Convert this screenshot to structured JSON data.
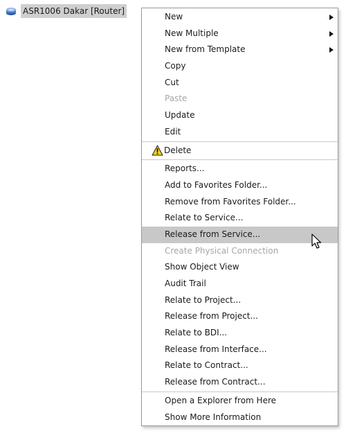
{
  "tree": {
    "node_label": "ASR1006 Dakar [Router]",
    "node_icon": "router-icon"
  },
  "menu": {
    "groups": [
      [
        {
          "label": "New",
          "submenu": true
        },
        {
          "label": "New Multiple",
          "submenu": true
        },
        {
          "label": "New from Template",
          "submenu": true
        },
        {
          "label": "Copy"
        },
        {
          "label": "Cut"
        },
        {
          "label": "Paste",
          "disabled": true
        },
        {
          "label": "Update"
        },
        {
          "label": "Edit"
        }
      ],
      [
        {
          "label": "Delete",
          "icon": "warning-icon"
        }
      ],
      [
        {
          "label": "Reports..."
        },
        {
          "label": "Add to Favorites Folder..."
        },
        {
          "label": "Remove from Favorites Folder..."
        },
        {
          "label": "Relate to Service..."
        },
        {
          "label": "Release from Service...",
          "hover": true
        },
        {
          "label": "Create Physical Connection",
          "disabled": true
        },
        {
          "label": "Show Object View"
        },
        {
          "label": "Audit Trail"
        },
        {
          "label": "Relate to Project..."
        },
        {
          "label": "Release from Project..."
        },
        {
          "label": "Relate to BDI..."
        },
        {
          "label": "Release from Interface..."
        },
        {
          "label": "Relate to Contract..."
        },
        {
          "label": "Release from Contract..."
        }
      ],
      [
        {
          "label": "Open a Explorer from Here"
        },
        {
          "label": "Show More Information"
        }
      ]
    ]
  },
  "colors": {
    "highlight": "#c8c8c8",
    "disabled_text": "#a6a6a6",
    "warning_fill": "#f2d21b",
    "router_icon": "#4a78c2"
  },
  "cursor_icon": "mouse-pointer-icon"
}
